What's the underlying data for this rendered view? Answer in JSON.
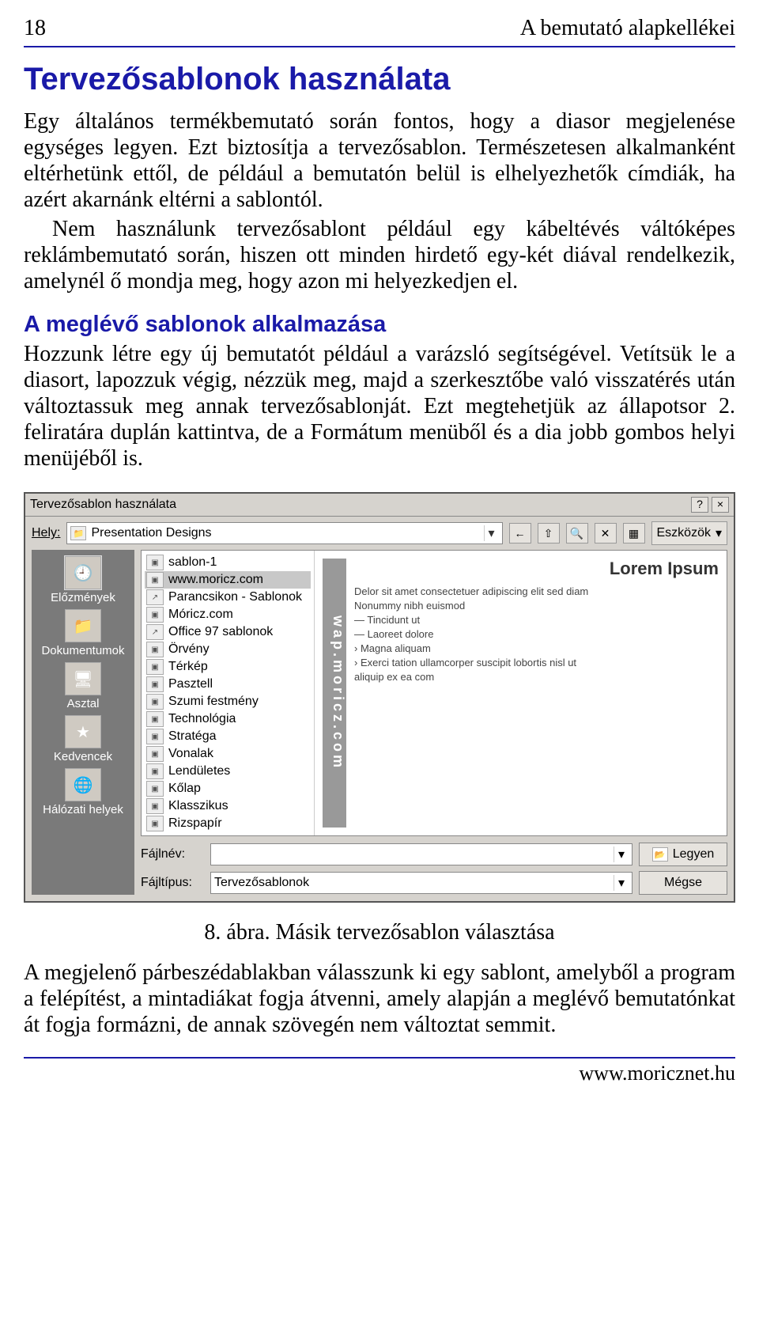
{
  "header": {
    "page_num": "18",
    "section": "A bemutató alapkellékei"
  },
  "h1": "Tervezősablonok használata",
  "para1": "Egy általános termékbemutató során fontos, hogy a diasor megjelenése egységes legyen. Ezt biztosítja a tervezősablon. Természetesen alkalmanként eltérhetünk ettől, de például a bemutatón belül is elhelyezhetők címdiák, ha azért akarnánk eltérni a sablontól.",
  "para2": "Nem használunk tervezősablont például egy kábeltévés váltóképes reklámbemutató során, hiszen ott minden hirdető egy-két diával rendelkezik, amelynél ő mondja meg, hogy azon mi helyezkedjen el.",
  "h2": "A meglévő sablonok alkalmazása",
  "para3": "Hozzunk létre egy új bemutatót például a varázsló segítségével. Vetítsük le a diasort, lapozzuk végig, nézzük meg, majd a szerkesztőbe való visszatérés után változtassuk meg annak tervezősablonját. Ezt megtehetjük az állapotsor 2. feliratára duplán kattintva, de a Formátum menüből és a dia jobb gombos helyi menüjéből is.",
  "caption": "8. ábra. Másik tervezősablon választása",
  "para4": "A megjelenő párbeszédablakban válasszunk ki egy sablont, amelyből a program a felépítést, a mintadiákat fogja átvenni, amely alapján a meglévő bemutatónkat át fogja formázni, de annak szövegén nem változtat semmit.",
  "footer": "www.moricznet.hu",
  "dialog": {
    "title": "Tervezősablon használata",
    "help_btn": "?",
    "close_btn": "×",
    "hely_label": "Hely:",
    "hely_value": "Presentation Designs",
    "tools_label": "Eszközök",
    "back_icon": "←",
    "up_icon": "⇧",
    "search_icon": "🔍",
    "x_icon": "✕",
    "grid_icon": "▦",
    "dd_glyph": "▾",
    "folder_glyph": "📁",
    "sidebar": [
      {
        "label": "Előzmények",
        "icon": "🕘"
      },
      {
        "label": "Dokumentumok",
        "icon": "📁"
      },
      {
        "label": "Asztal",
        "icon": "🖥"
      },
      {
        "label": "Kedvencek",
        "icon": "★"
      },
      {
        "label": "Hálózati helyek",
        "icon": "🌐"
      }
    ],
    "files": [
      {
        "name": "sablon-1",
        "type": "tpl"
      },
      {
        "name": "www.moricz.com",
        "type": "tpl",
        "selected": true
      },
      {
        "name": "Parancsikon - Sablonok",
        "type": "shortcut"
      },
      {
        "name": "Móricz.com",
        "type": "tpl"
      },
      {
        "name": "Office 97 sablonok",
        "type": "shortcut"
      },
      {
        "name": "Örvény",
        "type": "tpl"
      },
      {
        "name": "Térkép",
        "type": "tpl"
      },
      {
        "name": "Pasztell",
        "type": "tpl"
      },
      {
        "name": "Szumi festmény",
        "type": "tpl"
      },
      {
        "name": "Technológia",
        "type": "tpl"
      },
      {
        "name": "Stratéga",
        "type": "tpl"
      },
      {
        "name": "Vonalak",
        "type": "tpl"
      },
      {
        "name": "Lendületes",
        "type": "tpl"
      },
      {
        "name": "Kőlap",
        "type": "tpl"
      },
      {
        "name": "Klasszikus",
        "type": "tpl"
      },
      {
        "name": "Rizspapír",
        "type": "tpl"
      }
    ],
    "preview": {
      "side_text": "wap.moricz.com",
      "title": "Lorem Ipsum",
      "bullets": [
        "Delor sit amet consectetuer adipiscing elit sed diam",
        "Nonummy nibh euismod",
        "— Tincidunt ut",
        "— Laoreet dolore",
        "› Magna aliquam",
        "› Exerci tation ullamcorper suscipit lobortis nisl ut",
        "aliquip ex ea com"
      ]
    },
    "fajlnev_label": "Fájlnév:",
    "fajlnev_value": "",
    "fajltipus_label": "Fájltípus:",
    "fajltipus_value": "Tervezősablonok",
    "open_btn": "Legyen",
    "open_icon": "📂",
    "cancel_btn": "Mégse"
  }
}
